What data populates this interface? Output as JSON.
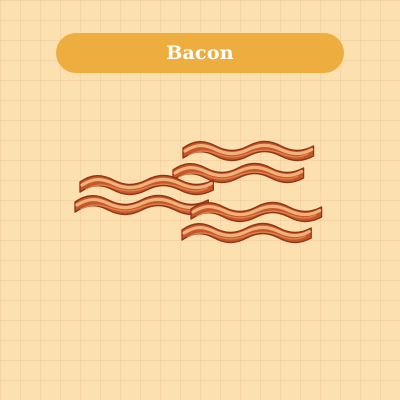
{
  "title": "Bacon",
  "colors": {
    "background": "#fde0b0",
    "pill": "#eead3f",
    "title_text": "#ffffff",
    "bacon_meat": "#c8582a",
    "bacon_fat": "#f0b27a",
    "bacon_outline": "#8e3518"
  },
  "illustration": {
    "subject": "bacon-strips",
    "strip_count": 6
  }
}
